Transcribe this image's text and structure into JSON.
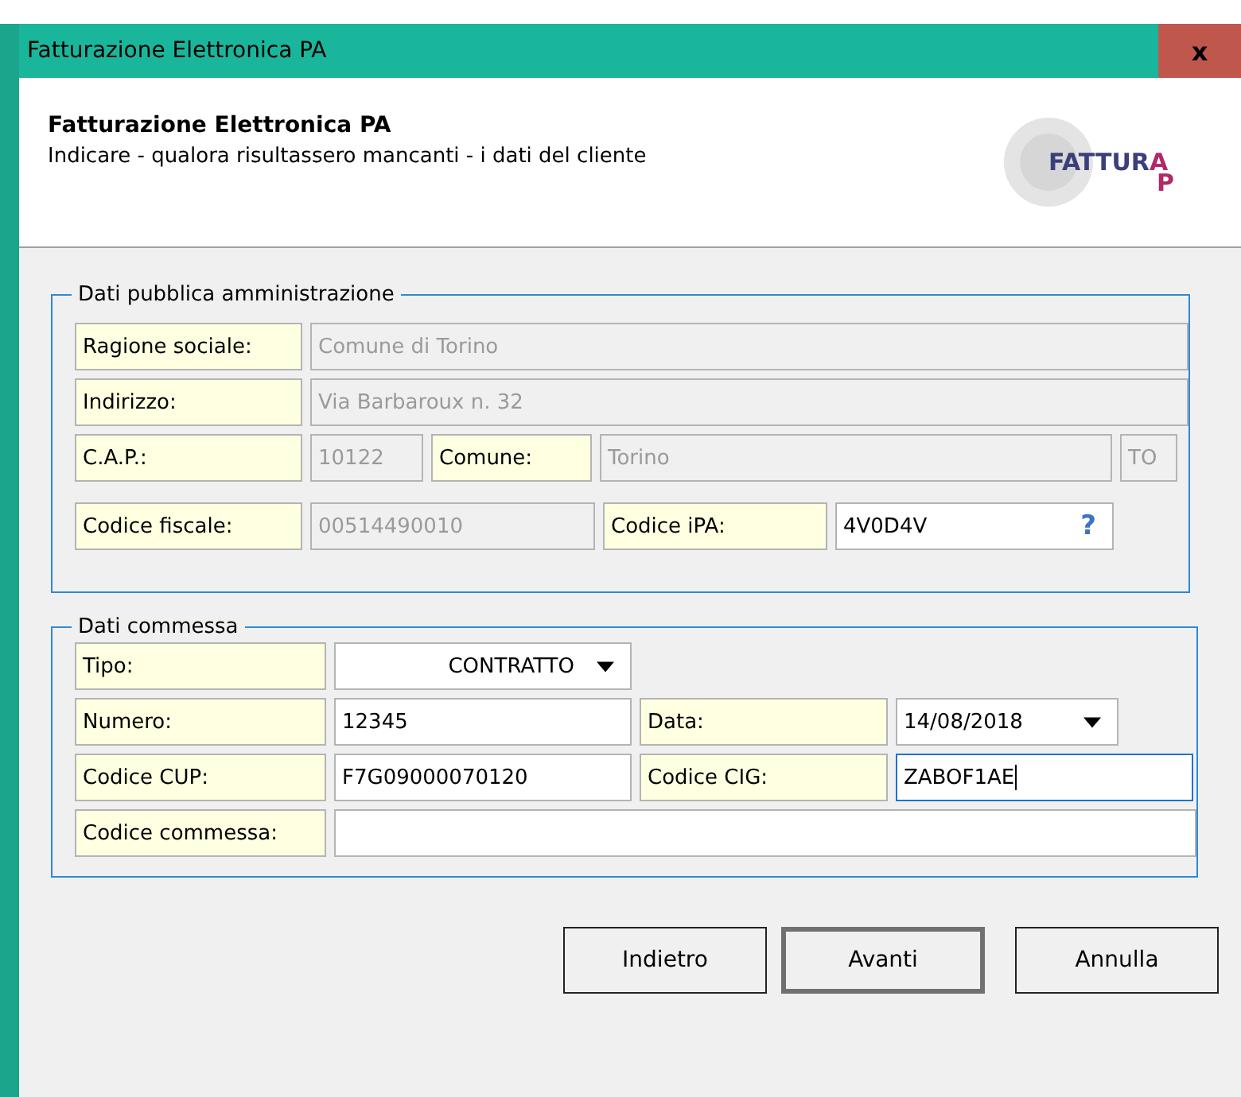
{
  "window": {
    "title": "Fatturazione Elettronica PA",
    "close": "x"
  },
  "header": {
    "title": "Fatturazione Elettronica PA",
    "subtitle": "Indicare - qualora risultassero mancanti - i dati del cliente",
    "logo": "FATTUR",
    "logo_tail": "A",
    "logo_sub": "P"
  },
  "groups": [
    {
      "title": "Dati pubblica amministrazione",
      "lines": [
        {
          "items": [
            {
              "kind": "label",
              "text": "Ragione sociale:"
            },
            {
              "kind": "field",
              "value": "Comune di Torino",
              "disabled": true,
              "focused": false
            }
          ]
        },
        {
          "items": [
            {
              "kind": "label",
              "text": "Indirizzo:"
            },
            {
              "kind": "field",
              "value": "Via Barbaroux n. 32",
              "disabled": true,
              "focused": false
            }
          ]
        },
        {
          "items": [
            {
              "kind": "label",
              "text": "C.A.P.:"
            },
            {
              "kind": "field",
              "value": "10122",
              "disabled": true,
              "focused": false
            },
            {
              "kind": "label",
              "text": "Comune:"
            },
            {
              "kind": "field",
              "value": "Torino",
              "disabled": true,
              "focused": false
            },
            {
              "kind": "field",
              "value": "TO",
              "disabled": true,
              "focused": false
            }
          ]
        },
        {
          "items": [
            {
              "kind": "label",
              "text": "Codice fiscale:"
            },
            {
              "kind": "field",
              "value": "00514490010",
              "disabled": true,
              "focused": false
            },
            {
              "kind": "label",
              "text": "Codice iPA:"
            },
            {
              "kind": "help-field",
              "value": "4V0D4V",
              "help": "?",
              "disabled": false,
              "focused": false
            }
          ]
        }
      ]
    },
    {
      "title": "Dati commessa",
      "lines": [
        {
          "items": [
            {
              "kind": "label",
              "text": "Tipo:"
            },
            {
              "kind": "dropdown",
              "value": "CONTRATTO",
              "disabled": false,
              "focused": false
            }
          ]
        },
        {
          "items": [
            {
              "kind": "label",
              "text": "Numero:"
            },
            {
              "kind": "field",
              "value": "12345",
              "disabled": false,
              "focused": false
            },
            {
              "kind": "label",
              "text": "Data:"
            },
            {
              "kind": "dropdown",
              "value": "14/08/2018",
              "disabled": false,
              "focused": false
            }
          ]
        },
        {
          "items": [
            {
              "kind": "label",
              "text": "Codice CUP:"
            },
            {
              "kind": "field",
              "value": "F7G09000070120",
              "disabled": false,
              "focused": false
            },
            {
              "kind": "label",
              "text": "Codice CIG:"
            },
            {
              "kind": "field",
              "value": "ZABOF1AE",
              "disabled": false,
              "focused": true
            }
          ]
        },
        {
          "items": [
            {
              "kind": "label",
              "text": "Codice commessa:"
            },
            {
              "kind": "field",
              "disabled": false,
              "focused": false
            }
          ]
        }
      ]
    }
  ],
  "buttons": [
    {
      "label": "Indietro",
      "default": false
    },
    {
      "label": "Avanti",
      "default": true
    },
    {
      "label": "Annulla",
      "default": false
    }
  ]
}
